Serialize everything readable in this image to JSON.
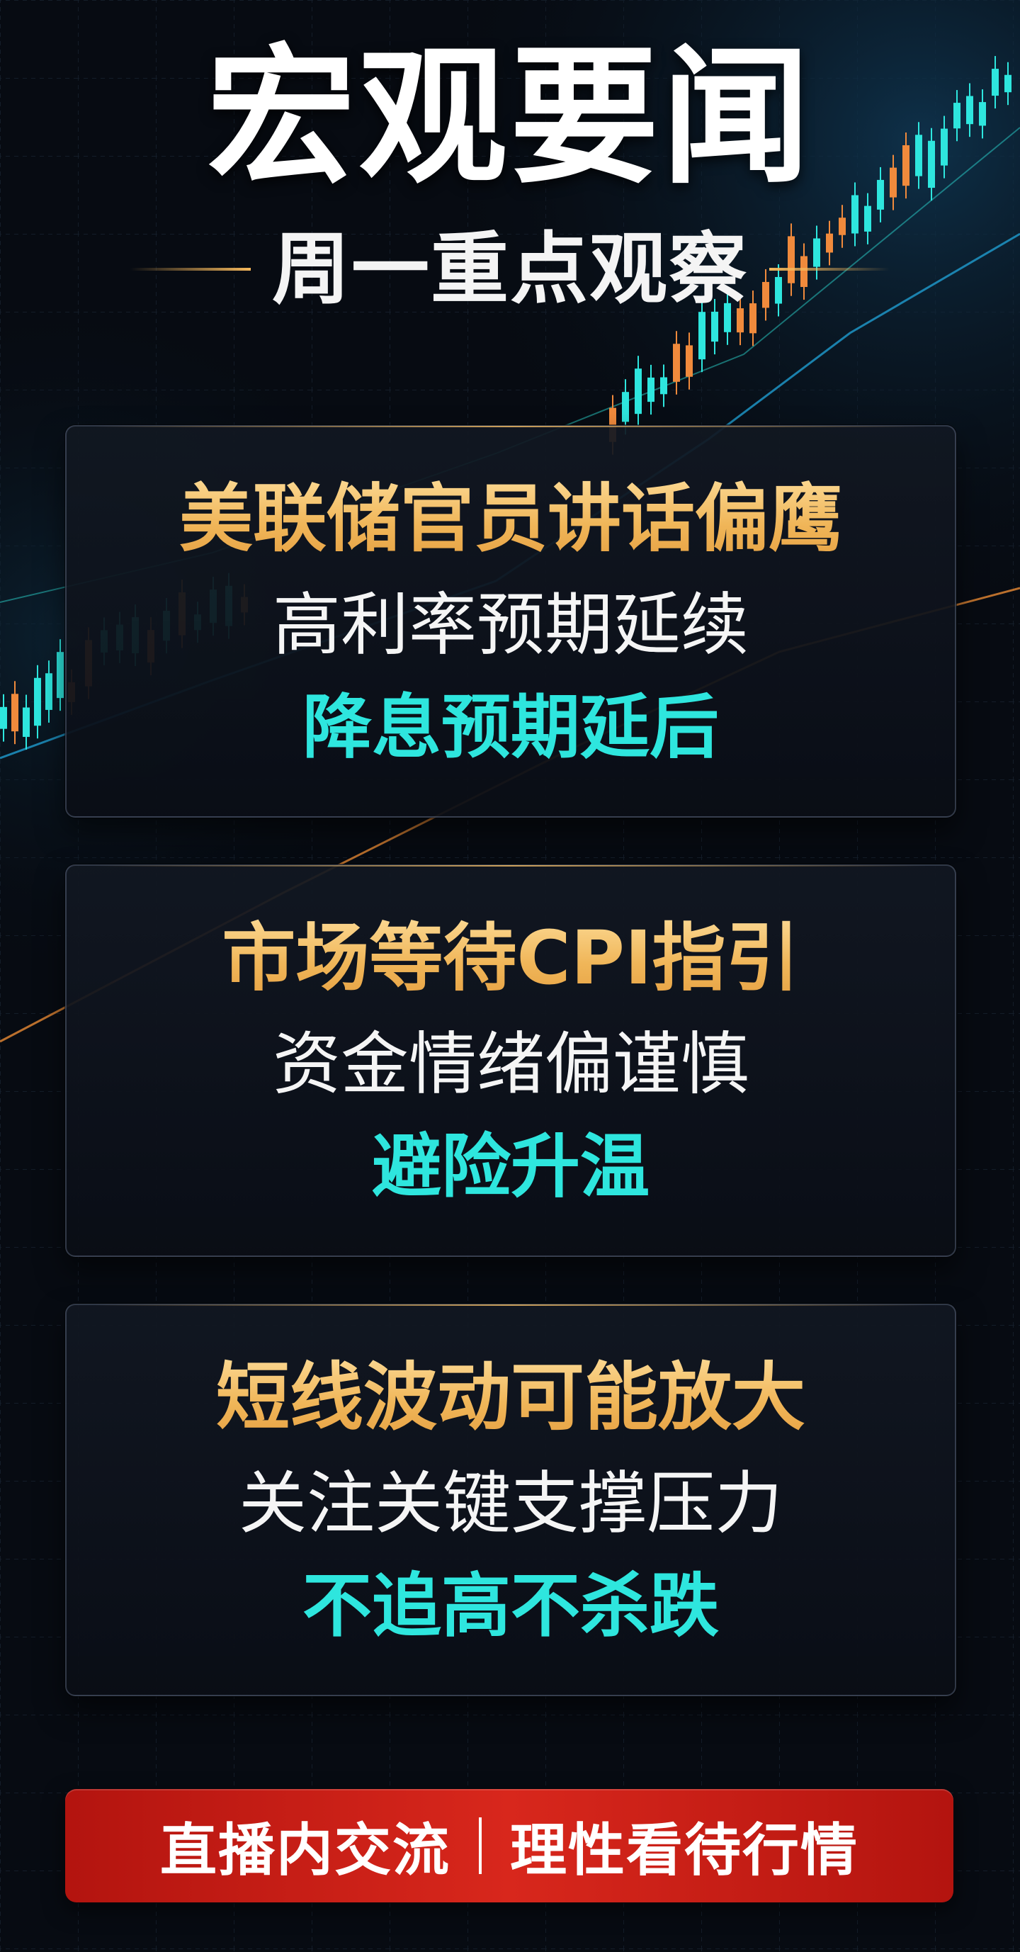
{
  "header": {
    "title": "宏观要闻",
    "subtitle": "周一重点观察"
  },
  "cards": [
    {
      "heading": "美联储官员讲话偏鹰",
      "line": "高利率预期延续",
      "highlight": "降息预期延后"
    },
    {
      "heading": "市场等待CPI指引",
      "line": "资金情绪偏谨慎",
      "highlight": "避险升温"
    },
    {
      "heading": "短线波动可能放大",
      "line": "关注关键支撑压力",
      "highlight": "不追高不杀跌"
    }
  ],
  "footer": {
    "left": "直播内交流",
    "right": "理性看待行情"
  },
  "colors": {
    "background": "#070b12",
    "heading_gold": "#f0b659",
    "highlight_cyan": "#2ee6de",
    "candle_up": "#2ee6de",
    "candle_down": "#f08a3c",
    "footer_red": "#d8271c"
  }
}
